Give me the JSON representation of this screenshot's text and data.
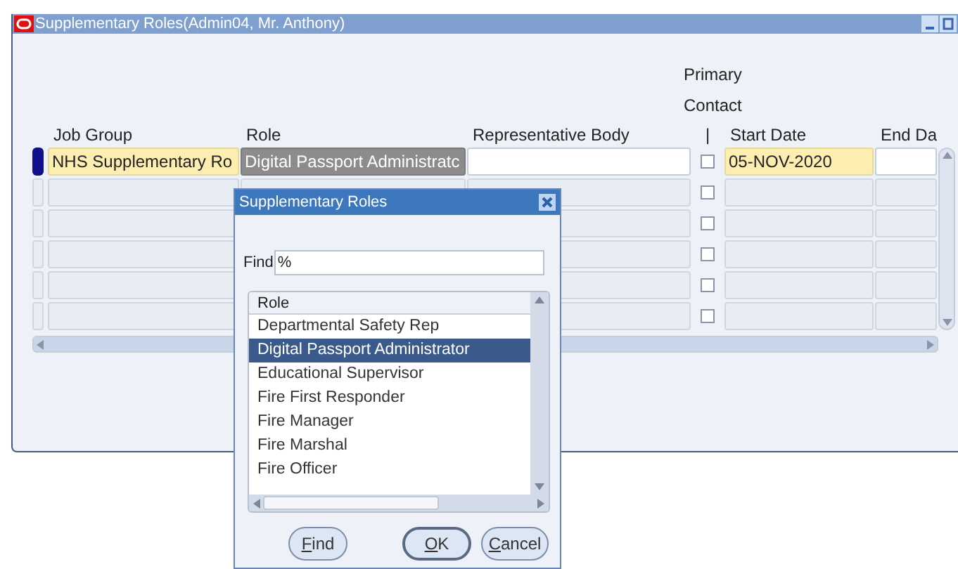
{
  "window": {
    "title": "Supplementary Roles(Admin04, Mr. Anthony)"
  },
  "primary_contact_heading": "Primary Contact",
  "columns": [
    {
      "label": "Job Group",
      "kind": "text"
    },
    {
      "label": "Role",
      "kind": "text"
    },
    {
      "label": "Representative Body",
      "kind": "text"
    },
    {
      "label": "|",
      "kind": "check"
    },
    {
      "label": "Start Date",
      "kind": "text"
    },
    {
      "label": "End Da",
      "kind": "text"
    }
  ],
  "rows": [
    {
      "current": true,
      "cells": [
        {
          "text": "NHS Supplementary Ro",
          "kind": "required"
        },
        {
          "text": "Digital Passport Administratc",
          "kind": "highlighted"
        },
        {
          "kind": "editable"
        },
        {
          "kind": "check",
          "checked": false
        },
        {
          "text": "05-NOV-2020",
          "kind": "required"
        },
        {
          "kind": "editable"
        }
      ]
    },
    {
      "current": false,
      "cells": [
        {
          "kind": "inactive"
        },
        {
          "kind": "inactive"
        },
        {
          "kind": "inactive"
        },
        {
          "kind": "check",
          "checked": false
        },
        {
          "kind": "inactive"
        },
        {
          "kind": "inactive"
        }
      ]
    },
    {
      "current": false,
      "cells": [
        {
          "kind": "inactive"
        },
        null,
        {
          "kind": "inactive"
        },
        {
          "kind": "check",
          "checked": false
        },
        {
          "kind": "inactive"
        },
        {
          "kind": "inactive"
        }
      ]
    },
    {
      "current": false,
      "cells": [
        {
          "kind": "inactive"
        },
        null,
        {
          "kind": "inactive"
        },
        {
          "kind": "check",
          "checked": false
        },
        {
          "kind": "inactive"
        },
        {
          "kind": "inactive"
        }
      ]
    },
    {
      "current": false,
      "cells": [
        {
          "kind": "inactive"
        },
        null,
        {
          "kind": "inactive"
        },
        {
          "kind": "check",
          "checked": false
        },
        {
          "kind": "inactive"
        },
        {
          "kind": "inactive"
        }
      ]
    },
    {
      "current": false,
      "cells": [
        {
          "kind": "inactive"
        },
        null,
        {
          "kind": "inactive"
        },
        {
          "kind": "check",
          "checked": false
        },
        {
          "kind": "inactive"
        },
        {
          "kind": "inactive"
        }
      ]
    }
  ],
  "dialog": {
    "title": "Supplementary Roles",
    "find_label": "Find",
    "find_value": "%",
    "list_heading": "Role",
    "items": [
      {
        "label": "Departmental Safety Rep",
        "selected": false
      },
      {
        "label": "Digital Passport Administrator",
        "selected": true
      },
      {
        "label": "Educational Supervisor",
        "selected": false
      },
      {
        "label": "Fire First Responder",
        "selected": false
      },
      {
        "label": "Fire Manager",
        "selected": false
      },
      {
        "label": "Fire Marshal",
        "selected": false
      },
      {
        "label": "Fire Officer",
        "selected": false
      }
    ],
    "buttons": [
      {
        "label": "Find",
        "default": false
      },
      {
        "label": "OK",
        "default": true
      },
      {
        "label": "Cancel",
        "default": false
      }
    ]
  }
}
